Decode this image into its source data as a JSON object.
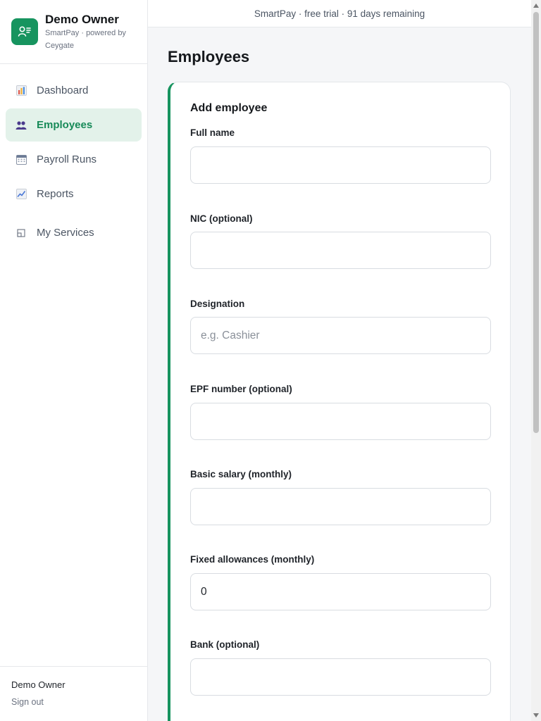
{
  "app": {
    "owner_name": "Demo Owner",
    "subtitle": "SmartPay · powered by Ceygate",
    "banner": "SmartPay · free trial · 91 days remaining"
  },
  "nav": {
    "items": [
      {
        "label": "Dashboard",
        "icon": "bar-chart-icon",
        "active": false
      },
      {
        "label": "Employees",
        "icon": "people-icon",
        "active": true
      },
      {
        "label": "Payroll Runs",
        "icon": "calendar-icon",
        "active": false
      },
      {
        "label": "Reports",
        "icon": "trend-chart-icon",
        "active": false
      },
      {
        "label": "My Services",
        "icon": "window-icon",
        "active": false
      }
    ]
  },
  "footer": {
    "user_name": "Demo Owner",
    "sign_out": "Sign out"
  },
  "page": {
    "title": "Employees"
  },
  "form": {
    "title": "Add employee",
    "fields": {
      "full_name": {
        "label": "Full name",
        "value": "",
        "placeholder": ""
      },
      "nic": {
        "label": "NIC (optional)",
        "value": "",
        "placeholder": ""
      },
      "designation": {
        "label": "Designation",
        "value": "",
        "placeholder": "e.g. Cashier"
      },
      "epf": {
        "label": "EPF number (optional)",
        "value": "",
        "placeholder": ""
      },
      "basic_salary": {
        "label": "Basic salary (monthly)",
        "value": "",
        "placeholder": ""
      },
      "allowances": {
        "label": "Fixed allowances (monthly)",
        "value": "0",
        "placeholder": ""
      },
      "bank": {
        "label": "Bank (optional)",
        "value": "",
        "placeholder": ""
      }
    }
  },
  "colors": {
    "accent": "#17945f",
    "active_bg": "#e3f2ea",
    "active_text": "#178a58"
  }
}
